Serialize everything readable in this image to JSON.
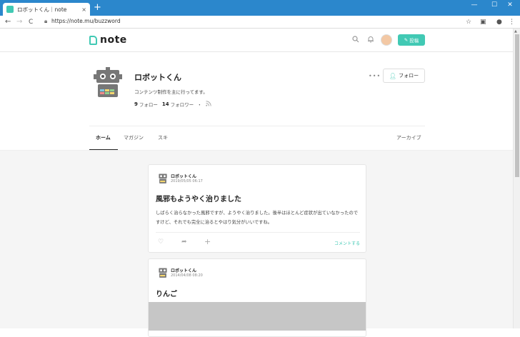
{
  "browser": {
    "tab_title": "ロボットくん｜note",
    "tab_close": "×",
    "new_tab": "+",
    "url": "https://note.mu/buzzword",
    "back": "←",
    "forward": "→",
    "reload": "C",
    "minimize": "—",
    "maximize": "☐",
    "close": "✕"
  },
  "header": {
    "logo_text": "note",
    "post_label": "投稿"
  },
  "profile": {
    "name": "ロボットくん",
    "description": "コンテンツ制作を主に行ってます。",
    "following_count": "9",
    "following_label": "フォロー",
    "followers_count": "14",
    "followers_label": "フォロワー",
    "separator": "・",
    "more": "•••",
    "follow_label": "フォロー"
  },
  "tabs": {
    "home": "ホーム",
    "magazine": "マガジン",
    "like": "スキ",
    "archive": "アーカイブ"
  },
  "posts": [
    {
      "author": "ロボットくん",
      "date": "2019/05/05 06:17",
      "title": "風邪もようやく治りました",
      "body": "しばらく治らなかった風邪ですが、ようやく治りました。後半はほとんど症状が出ていなかったのですけど、それでも完全に治るとやはり気分がいいですね。",
      "comment": "コメントする"
    },
    {
      "author": "ロボットくん",
      "date": "2014/04/08 08:20",
      "title": "りんご"
    }
  ],
  "colors": {
    "accent": "#41c9b4",
    "titlebar": "#2b87cc"
  }
}
